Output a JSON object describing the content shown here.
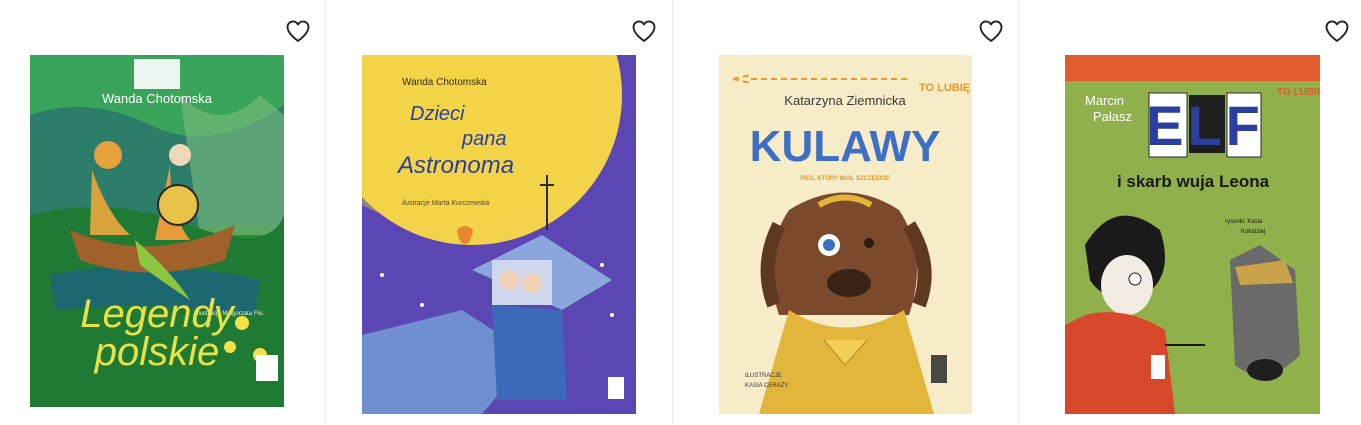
{
  "products": [
    {
      "author": "Wanda Chotomska",
      "title_line1": "Legendy",
      "title_line2": "polskie",
      "illustrator": "ilustracje Małgorzata Flis",
      "favorite_icon": "heart-outline-icon"
    },
    {
      "author": "Wanda Chotomska",
      "title_line1": "Dzieci",
      "title_line2": "pana",
      "title_line3": "Astronoma",
      "illustrator": "ilustracje Marta Kurczewska",
      "favorite_icon": "heart-outline-icon"
    },
    {
      "series": "TO LUBIĘ",
      "author": "Katarzyna Ziemnicka",
      "title": "KULAWY",
      "subtitle": "PIES, KTÓRY MIAŁ SZCZĘŚCIE",
      "illustrator_line1": "ILUSTRACJE",
      "illustrator_line2": "KASIA CERAZY",
      "favorite_icon": "heart-outline-icon"
    },
    {
      "series": "TO LUBIĘ",
      "author_line1": "Marcin",
      "author_line2": "Pałasz",
      "title": "ELF",
      "subtitle": "i skarb wuja Leona",
      "illustrator_line1": "rysunki: Kasia",
      "illustrator_line2": "Kołodziej",
      "favorite_icon": "heart-outline-icon"
    }
  ],
  "colors": {
    "heart_stroke": "#222222",
    "divider": "#ececec"
  }
}
